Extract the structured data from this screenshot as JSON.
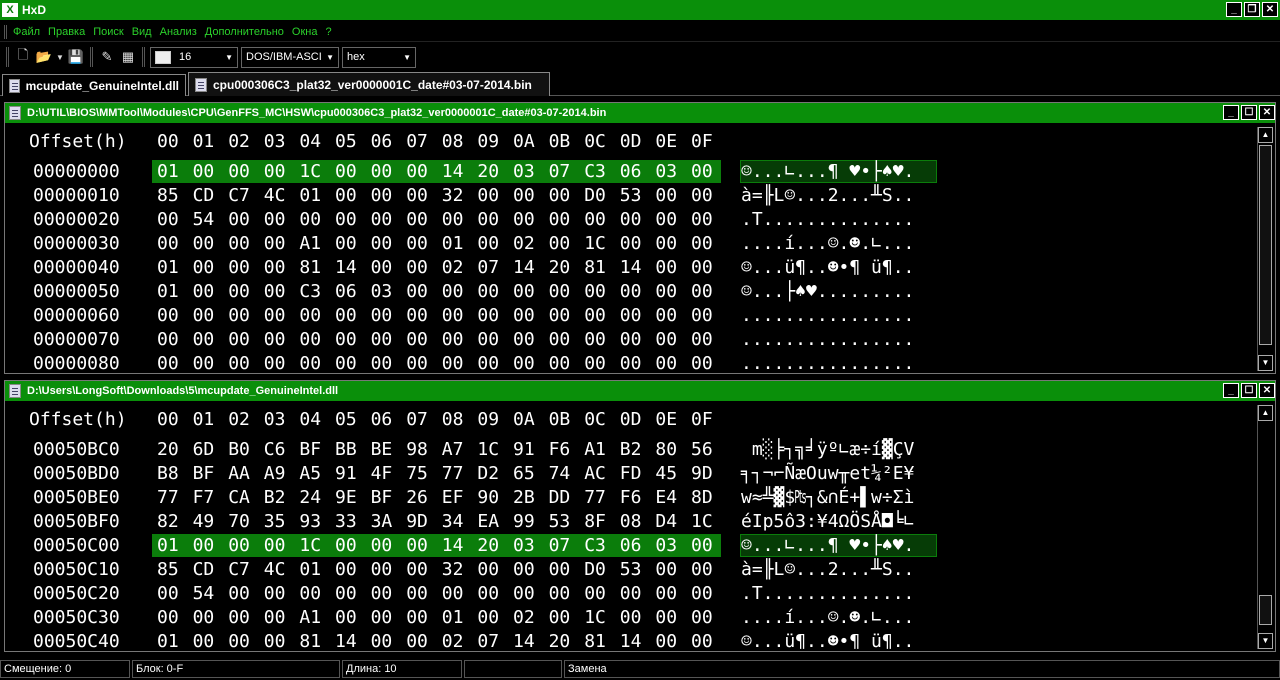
{
  "window": {
    "title": "HxD",
    "icon_label": "X"
  },
  "menu": [
    "Файл",
    "Правка",
    "Поиск",
    "Вид",
    "Анализ",
    "Дополнительно",
    "Окна",
    "?"
  ],
  "toolbar": {
    "bytes_per_row": "16",
    "charset": "DOS/IBM-ASCI",
    "offset_base": "hex"
  },
  "tabs": [
    {
      "label": "mcupdate_GenuineIntel.dll",
      "active": false
    },
    {
      "label": "cpu000306C3_plat32_ver0000001C_date#03-07-2014.bin",
      "active": true
    }
  ],
  "panes": [
    {
      "path": "D:\\UTIL\\BIOS\\MMTool\\Modules\\CPU\\GenFFS_MC\\HSW\\cpu000306C3_plat32_ver0000001C_date#03-07-2014.bin",
      "header_offset": "Offset(h)",
      "header_cols": [
        "00",
        "01",
        "02",
        "03",
        "04",
        "05",
        "06",
        "07",
        "08",
        "09",
        "0A",
        "0B",
        "0C",
        "0D",
        "0E",
        "0F"
      ],
      "highlight_row": 0,
      "rows": [
        {
          "offset": "00000000",
          "bytes": [
            "01",
            "00",
            "00",
            "00",
            "1C",
            "00",
            "00",
            "00",
            "14",
            "20",
            "03",
            "07",
            "C3",
            "06",
            "03",
            "00"
          ],
          "text": "☺...∟...¶ ♥•├♠♥."
        },
        {
          "offset": "00000010",
          "bytes": [
            "85",
            "CD",
            "C7",
            "4C",
            "01",
            "00",
            "00",
            "00",
            "32",
            "00",
            "00",
            "00",
            "D0",
            "53",
            "00",
            "00"
          ],
          "text": "à=╟L☺...2...╨S.."
        },
        {
          "offset": "00000020",
          "bytes": [
            "00",
            "54",
            "00",
            "00",
            "00",
            "00",
            "00",
            "00",
            "00",
            "00",
            "00",
            "00",
            "00",
            "00",
            "00",
            "00"
          ],
          "text": ".T.............."
        },
        {
          "offset": "00000030",
          "bytes": [
            "00",
            "00",
            "00",
            "00",
            "A1",
            "00",
            "00",
            "00",
            "01",
            "00",
            "02",
            "00",
            "1C",
            "00",
            "00",
            "00"
          ],
          "text": "....í...☺.☻.∟..."
        },
        {
          "offset": "00000040",
          "bytes": [
            "01",
            "00",
            "00",
            "00",
            "81",
            "14",
            "00",
            "00",
            "02",
            "07",
            "14",
            "20",
            "81",
            "14",
            "00",
            "00"
          ],
          "text": "☺...ü¶..☻•¶ ü¶.."
        },
        {
          "offset": "00000050",
          "bytes": [
            "01",
            "00",
            "00",
            "00",
            "C3",
            "06",
            "03",
            "00",
            "00",
            "00",
            "00",
            "00",
            "00",
            "00",
            "00",
            "00"
          ],
          "text": "☺...├♠♥........."
        },
        {
          "offset": "00000060",
          "bytes": [
            "00",
            "00",
            "00",
            "00",
            "00",
            "00",
            "00",
            "00",
            "00",
            "00",
            "00",
            "00",
            "00",
            "00",
            "00",
            "00"
          ],
          "text": "................"
        },
        {
          "offset": "00000070",
          "bytes": [
            "00",
            "00",
            "00",
            "00",
            "00",
            "00",
            "00",
            "00",
            "00",
            "00",
            "00",
            "00",
            "00",
            "00",
            "00",
            "00"
          ],
          "text": "................"
        },
        {
          "offset": "00000080",
          "bytes": [
            "00",
            "00",
            "00",
            "00",
            "00",
            "00",
            "00",
            "00",
            "00",
            "00",
            "00",
            "00",
            "00",
            "00",
            "00",
            "00"
          ],
          "text": "................"
        }
      ]
    },
    {
      "path": "D:\\Users\\LongSoft\\Downloads\\5\\mcupdate_GenuineIntel.dll",
      "header_offset": "Offset(h)",
      "header_cols": [
        "00",
        "01",
        "02",
        "03",
        "04",
        "05",
        "06",
        "07",
        "08",
        "09",
        "0A",
        "0B",
        "0C",
        "0D",
        "0E",
        "0F"
      ],
      "highlight_row": 4,
      "rows": [
        {
          "offset": "00050BC0",
          "bytes": [
            "20",
            "6D",
            "B0",
            "C6",
            "BF",
            "BB",
            "BE",
            "98",
            "A7",
            "1C",
            "91",
            "F6",
            "A1",
            "B2",
            "80",
            "56"
          ],
          "text": " m░╞┐╗╛ÿº∟æ÷í▓ÇV"
        },
        {
          "offset": "00050BD0",
          "bytes": [
            "B8",
            "BF",
            "AA",
            "A9",
            "A5",
            "91",
            "4F",
            "75",
            "77",
            "D2",
            "65",
            "74",
            "AC",
            "FD",
            "45",
            "9D"
          ],
          "text": "╕┐¬⌐ÑæOuw╥et¼²E¥"
        },
        {
          "offset": "00050BE0",
          "bytes": [
            "77",
            "F7",
            "CA",
            "B2",
            "24",
            "9E",
            "BF",
            "26",
            "EF",
            "90",
            "2B",
            "DD",
            "77",
            "F6",
            "E4",
            "8D"
          ],
          "text": "w≈╩▓$₧┐&∩É+▌w÷Σì"
        },
        {
          "offset": "00050BF0",
          "bytes": [
            "82",
            "49",
            "70",
            "35",
            "93",
            "33",
            "3A",
            "9D",
            "34",
            "EA",
            "99",
            "53",
            "8F",
            "08",
            "D4",
            "1C"
          ],
          "text": "éIp5ô3:¥4ΩÖSÅ◘╘∟"
        },
        {
          "offset": "00050C00",
          "bytes": [
            "01",
            "00",
            "00",
            "00",
            "1C",
            "00",
            "00",
            "00",
            "14",
            "20",
            "03",
            "07",
            "C3",
            "06",
            "03",
            "00"
          ],
          "text": "☺...∟...¶ ♥•├♠♥."
        },
        {
          "offset": "00050C10",
          "bytes": [
            "85",
            "CD",
            "C7",
            "4C",
            "01",
            "00",
            "00",
            "00",
            "32",
            "00",
            "00",
            "00",
            "D0",
            "53",
            "00",
            "00"
          ],
          "text": "à=╟L☺...2...╨S.."
        },
        {
          "offset": "00050C20",
          "bytes": [
            "00",
            "54",
            "00",
            "00",
            "00",
            "00",
            "00",
            "00",
            "00",
            "00",
            "00",
            "00",
            "00",
            "00",
            "00",
            "00"
          ],
          "text": ".T.............."
        },
        {
          "offset": "00050C30",
          "bytes": [
            "00",
            "00",
            "00",
            "00",
            "A1",
            "00",
            "00",
            "00",
            "01",
            "00",
            "02",
            "00",
            "1C",
            "00",
            "00",
            "00"
          ],
          "text": "....í...☺.☻.∟..."
        },
        {
          "offset": "00050C40",
          "bytes": [
            "01",
            "00",
            "00",
            "00",
            "81",
            "14",
            "00",
            "00",
            "02",
            "07",
            "14",
            "20",
            "81",
            "14",
            "00",
            "00"
          ],
          "text": "☺...ü¶..☻•¶ ü¶.."
        }
      ]
    }
  ],
  "status": {
    "offset": "Смещение: 0",
    "block": "Блок: 0-F",
    "length": "Длина: 10",
    "mode": "",
    "replace": "Замена"
  }
}
